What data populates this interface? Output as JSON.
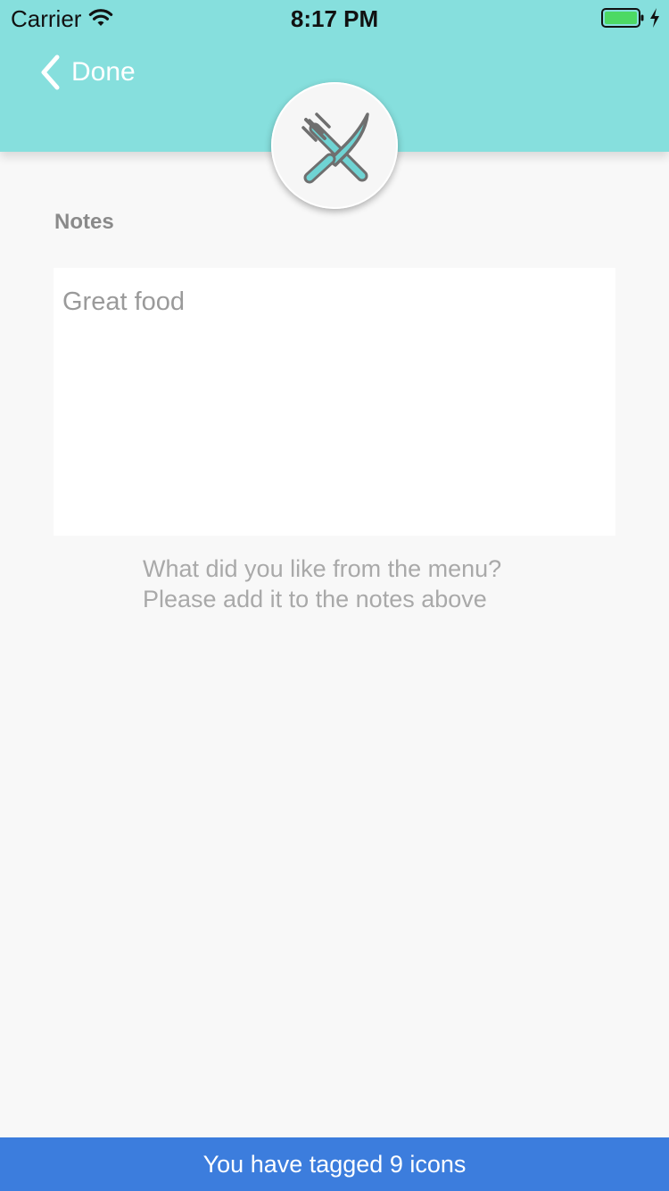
{
  "status_bar": {
    "carrier": "Carrier",
    "time": "8:17 PM",
    "wifi_icon": "wifi-icon",
    "battery_icon": "battery-icon",
    "charging_icon": "lightning-icon"
  },
  "header": {
    "back_label": "Done",
    "back_icon": "chevron-left-icon",
    "category_icon": "fork-knife-icon"
  },
  "notes": {
    "label": "Notes",
    "value": "Great food",
    "hint_line1": "What did you like from the menu?",
    "hint_line2": "Please add it to the notes above"
  },
  "footer": {
    "message": "You have tagged 9 icons"
  },
  "colors": {
    "header_bg": "#86dfdd",
    "accent": "#6fd3d3",
    "icon_outline": "#6f6f6f",
    "footer_bg": "#3c7ddd",
    "battery_fill": "#4cd964",
    "page_bg": "#f8f8f8"
  }
}
